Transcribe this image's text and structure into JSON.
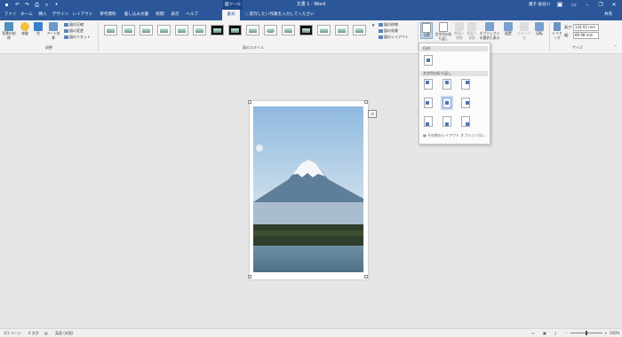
{
  "titlebar": {
    "doc_title": "文書 1 - Word",
    "context_tab": "図ツール",
    "user_name": "蓮子 長谷川",
    "qa_icons": [
      "save-icon",
      "undo-icon",
      "redo-icon",
      "print-preview-icon",
      "zoom-icon"
    ]
  },
  "tabs": [
    "ファイル",
    "ホーム",
    "挿入",
    "デザイン",
    "レイアウト",
    "参考資料",
    "差し込み文書",
    "校閲",
    "表示",
    "ヘルプ",
    "書式"
  ],
  "active_tab": "書式",
  "tell_me": "実行したい作業を入力してください",
  "share": "共有",
  "ribbon": {
    "adjust": {
      "label": "調整",
      "remove_bg": "背景の削除",
      "corrections": "修整",
      "color": "色",
      "artistic": "アート効果",
      "compress": "図の圧縮",
      "change": "図の変更",
      "reset": "図のリセット"
    },
    "styles": {
      "label": "図のスタイル",
      "border": "図の枠線",
      "effects": "図の効果",
      "layout": "図のレイアウト"
    },
    "arrange": {
      "position": "位置",
      "wrap": "文字列の折り返し",
      "forward": "前面へ移動",
      "backward": "背面へ移動",
      "selection_pane": "オブジェクトの選択と表示",
      "align": "配置",
      "group": "グループ化",
      "rotate": "回転"
    },
    "size": {
      "label": "サイズ",
      "crop": "トリミング",
      "height_label": "高さ:",
      "height_value": "134.92 mm",
      "width_label": "幅:",
      "width_value": "89.98 mm"
    }
  },
  "position_dropdown": {
    "inline_header": "行内",
    "wrap_header": "文字列の折り返し",
    "more_options": "その他のレイアウト オプション(L)..."
  },
  "status": {
    "page": "1/1 ページ",
    "words": "0 文字",
    "language": "英語 (米国)",
    "zoom": "100%"
  },
  "colors": {
    "accent": "#2b579a",
    "ribbon_bg": "#f3f3f3",
    "canvas_bg": "#e6e6e6"
  }
}
